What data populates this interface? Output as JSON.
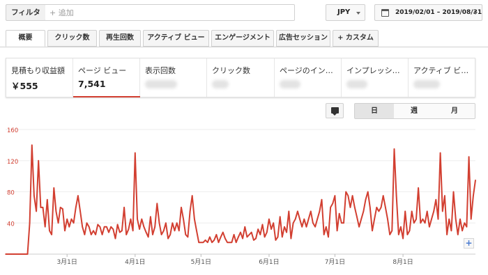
{
  "toolbar": {
    "filter_label": "フィルタ",
    "filter_placeholder": "+ 追加",
    "currency": "JPY",
    "date_range": "2019/02/01 – 2019/08/31"
  },
  "tabs": [
    "概要",
    "クリック数",
    "再生回数",
    "アクティブ ビュー",
    "エンゲージメント",
    "広告セッション",
    "+ カスタム"
  ],
  "metrics": [
    {
      "label": "見積もり収益額",
      "value": "￥555"
    },
    {
      "label": "ページ ビュー",
      "value": "7,541"
    },
    {
      "label": "表示回数",
      "value": ""
    },
    {
      "label": "クリック数",
      "value": ""
    },
    {
      "label": "ページのイン…",
      "value": ""
    },
    {
      "label": "インプレッシ…",
      "value": ""
    },
    {
      "label": "アクティブ ビ…",
      "value": ""
    }
  ],
  "granularity": [
    "日",
    "週",
    "月"
  ],
  "chart_data": {
    "type": "line",
    "series_color": "#d23f31",
    "ylim": [
      0,
      160
    ],
    "yticks": [
      40,
      80,
      120,
      160
    ],
    "x_tick_labels": [
      "3月1日",
      "4月1日",
      "5月1日",
      "6月1日",
      "7月1日",
      "8月1日"
    ],
    "x_tick_index": [
      28,
      59,
      89,
      120,
      150,
      181
    ],
    "grid": true,
    "values": [
      0,
      0,
      0,
      0,
      0,
      0,
      0,
      0,
      0,
      0,
      0,
      40,
      140,
      75,
      55,
      120,
      60,
      60,
      35,
      70,
      30,
      25,
      85,
      55,
      40,
      60,
      58,
      30,
      45,
      35,
      45,
      40,
      60,
      75,
      55,
      35,
      25,
      40,
      35,
      25,
      30,
      25,
      38,
      35,
      25,
      35,
      35,
      28,
      35,
      32,
      20,
      38,
      28,
      30,
      60,
      25,
      32,
      45,
      30,
      130,
      45,
      32,
      45,
      35,
      28,
      22,
      48,
      25,
      35,
      65,
      40,
      25,
      30,
      40,
      20,
      25,
      40,
      30,
      40,
      30,
      60,
      45,
      25,
      22,
      55,
      75,
      45,
      30,
      15,
      15,
      15,
      18,
      15,
      22,
      15,
      18,
      25,
      15,
      22,
      28,
      20,
      15,
      15,
      15,
      25,
      15,
      22,
      28,
      20,
      35,
      22,
      25,
      28,
      18,
      20,
      32,
      25,
      38,
      22,
      28,
      45,
      32,
      40,
      18,
      22,
      48,
      22,
      35,
      28,
      55,
      20,
      40,
      45,
      55,
      45,
      35,
      45,
      35,
      45,
      55,
      40,
      35,
      45,
      55,
      70,
      25,
      35,
      22,
      60,
      65,
      75,
      30,
      52,
      40,
      40,
      80,
      75,
      60,
      75,
      60,
      48,
      35,
      45,
      55,
      70,
      80,
      60,
      30,
      45,
      60,
      55,
      60,
      75,
      60,
      45,
      25,
      30,
      135,
      75,
      25,
      35,
      20,
      55,
      25,
      30,
      55,
      40,
      45,
      85,
      40,
      45,
      40,
      55,
      35,
      45,
      55,
      70,
      45,
      130,
      55,
      75,
      25,
      45,
      30,
      80,
      45,
      25,
      45,
      30,
      40,
      35,
      125,
      45,
      75,
      95
    ]
  }
}
